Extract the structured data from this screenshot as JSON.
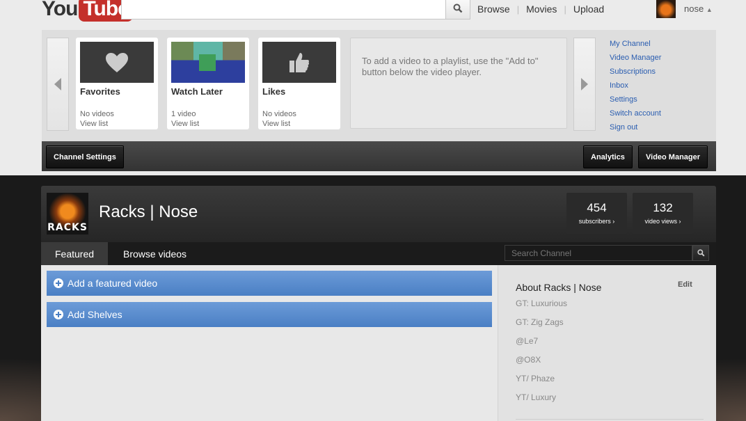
{
  "masthead": {
    "logo_you": "You",
    "logo_tube": "Tube",
    "nav": [
      "Browse",
      "Movies",
      "Upload"
    ],
    "username": "nose"
  },
  "guide": {
    "playlists": [
      {
        "title": "Favorites",
        "count": "No videos",
        "link": "View list",
        "thumb_icon": "heart-icon"
      },
      {
        "title": "Watch Later",
        "count": "1 video",
        "link": "View list",
        "thumb_icon": "minecraft-thumbnail"
      },
      {
        "title": "Likes",
        "count": "No videos",
        "link": "View list",
        "thumb_icon": "thumbs-up-icon"
      }
    ],
    "info_text": "To add a video to a playlist, use the \"Add to\" button below the video player.",
    "links": [
      "My Channel",
      "Video Manager",
      "Subscriptions",
      "Inbox",
      "Settings",
      "Switch account",
      "Sign out"
    ]
  },
  "action_bar": {
    "channel_settings": "Channel Settings",
    "analytics": "Analytics",
    "video_manager": "Video Manager"
  },
  "channel": {
    "avatar_text": "RACKS",
    "name": "Racks | Nose",
    "subscribers": {
      "value": "454",
      "label": "subscribers ›"
    },
    "video_views": {
      "value": "132",
      "label": "video views ›"
    },
    "tabs": [
      "Featured",
      "Browse videos"
    ],
    "search_placeholder": "Search Channel",
    "add_featured": "Add a featured video",
    "add_shelves": "Add Shelves",
    "about": {
      "title": "About Racks | Nose",
      "edit": "Edit",
      "lines": [
        "GT: Luxurious",
        "GT: Zig Zags",
        "@Le7",
        "@O8X",
        "YT/ Phaze",
        "YT/ Luxury"
      ]
    }
  },
  "colors": {
    "link_blue": "#2a5db0",
    "featured_blue": "#5a8bcf",
    "youtube_red": "#c4302b"
  }
}
